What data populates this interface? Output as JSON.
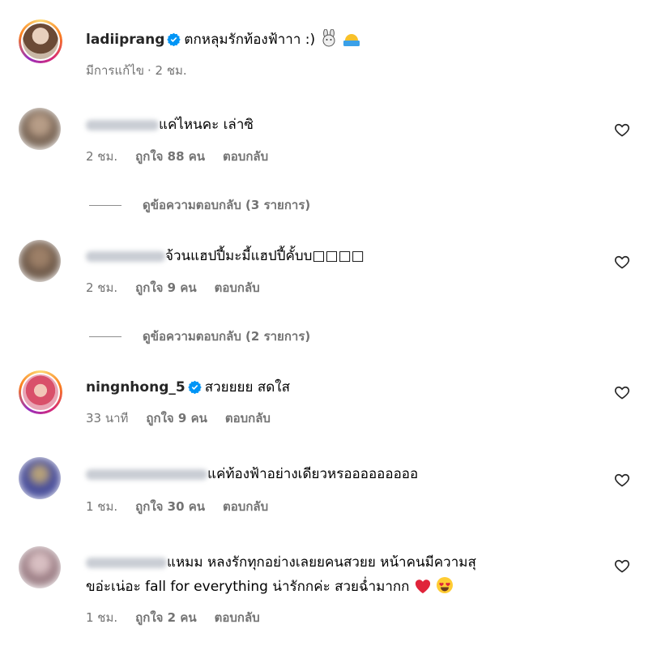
{
  "post": {
    "username": "ladiiprang",
    "caption": "ตกหลุมรักท้องฟ้าาา :)",
    "edited": "มีการแก้ไข",
    "time": "2 ชม."
  },
  "comments": [
    {
      "text": "แค่ไหนคะ เล่าซิ",
      "time": "2 ชม.",
      "likes": "ถูกใจ 88 คน",
      "reply": "ตอบกลับ",
      "view_replies": "ดูข้อความตอบกลับ (3 รายการ)"
    },
    {
      "text": "จ้วนแฮปปี้มะมี้แฮปปี้คั้บบ□□□□",
      "time": "2 ชม.",
      "likes": "ถูกใจ 9 คน",
      "reply": "ตอบกลับ",
      "view_replies": "ดูข้อความตอบกลับ (2 รายการ)"
    },
    {
      "username": "ningnhong_5",
      "text": "สวยยยย สดใส",
      "time": "33 นาที",
      "likes": "ถูกใจ 9 คน",
      "reply": "ตอบกลับ"
    },
    {
      "text": "แค่ท้องฟ้าอย่างเดียวหรอออออออออ",
      "time": "1 ชม.",
      "likes": "ถูกใจ 30 คน",
      "reply": "ตอบกลับ"
    },
    {
      "text_line1": "แหมม หลงรักทุกอย่างเลยยคนสวยย หน้าคนมีความสุ",
      "text_line2": "ขอ่ะเน่อะ fall for everything น่ารักกค่ะ สวยฉ่ำมากก",
      "time": "1 ชม.",
      "likes": "ถูกใจ 2 คน",
      "reply": "ตอบกลับ"
    }
  ],
  "colors": {
    "meta": "#737373",
    "verified": "#0095f6",
    "heart_outline": "#262626"
  },
  "icons": [
    "verified-badge-icon",
    "heart-outline-icon",
    "rabbit-emoji-icon",
    "sun-emoji-icon",
    "red-heart-emoji-icon",
    "heart-eyes-emoji-icon"
  ]
}
